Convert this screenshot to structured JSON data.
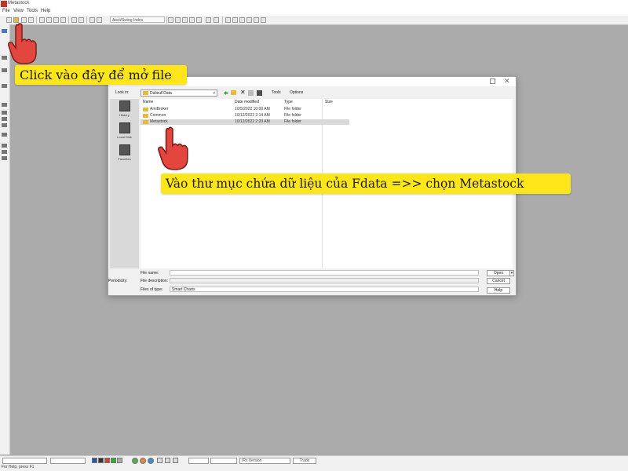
{
  "app": {
    "title": "Metastock"
  },
  "menu": [
    "File",
    "View",
    "Tools",
    "Help"
  ],
  "toolbar": {
    "security_select": "Ascii/Swing Index"
  },
  "dialog": {
    "look_in_label": "Look in:",
    "look_in_value": "DulieuFData",
    "tools_label": "Tools",
    "options_label": "Options",
    "places": [
      "History",
      "Local Disk",
      "Favorites"
    ],
    "columns": {
      "name": "Name",
      "date": "Date modified",
      "type": "Type",
      "size": "Size"
    },
    "files": [
      {
        "name": "AmiBroker",
        "date": "10/5/2022 10:00 AM",
        "type": "File folder"
      },
      {
        "name": "Common",
        "date": "10/12/2022 2:14 AM",
        "type": "File folder"
      },
      {
        "name": "Metastock",
        "date": "10/12/2022 2:20 AM",
        "type": "File folder",
        "selected": true
      }
    ],
    "file_name_label": "File name:",
    "file_name_value": "",
    "periodicity_label": "Periodicity:",
    "file_description_label": "File description:",
    "files_of_type_label": "Files of type:",
    "files_of_type_value": "Smart Charts",
    "open_button": "Open",
    "cancel_button": "Cancel",
    "help_button": "Help"
  },
  "bottombar": {
    "version_select": "/Rx Version",
    "trade_button": "Trade"
  },
  "status": {
    "text": "For Help, press F1"
  },
  "callouts": {
    "open_file": "Click vào đây để mở file",
    "choose_folder": "Vào thư mục chứa dữ liệu của Fdata =>> chọn Metastock"
  },
  "colors": {
    "callout": "#ffe61a",
    "workspace": "#ababab",
    "hand": "#e2463f",
    "folder": "#e7b93c"
  }
}
